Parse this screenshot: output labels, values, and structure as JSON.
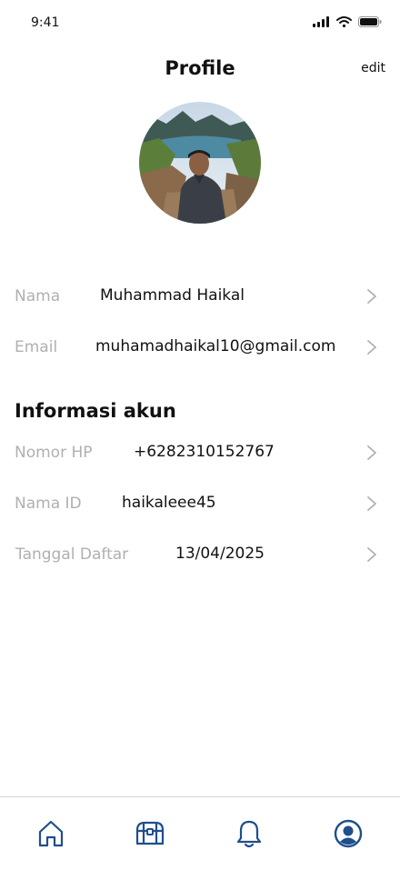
{
  "status_bar": {
    "time": "9:41",
    "icons": [
      "signal-icon",
      "wifi-icon",
      "battery-icon"
    ]
  },
  "header": {
    "title": "Profile",
    "edit_label": "edit"
  },
  "profile": {
    "nama_label": "Nama",
    "nama_value": "Muhammad Haikal",
    "email_label": "Email",
    "email_value": "muhamadhaikal10@gmail.com"
  },
  "account": {
    "title": "Informasi akun",
    "phone_label": "Nomor HP",
    "phone_value": "+6282310152767",
    "id_label": "Nama ID",
    "id_value": "haikaleee45",
    "date_label": "Tanggal Daftar",
    "date_value": "13/04/2025"
  },
  "tab_bar": {
    "tabs": [
      "home-icon",
      "treasure-chest-icon",
      "bell-icon",
      "profile-icon"
    ],
    "active": "profile",
    "color": "#1f4e8c"
  },
  "colors": {
    "label": "#b0b0b0",
    "accent": "#1f4e8c"
  }
}
